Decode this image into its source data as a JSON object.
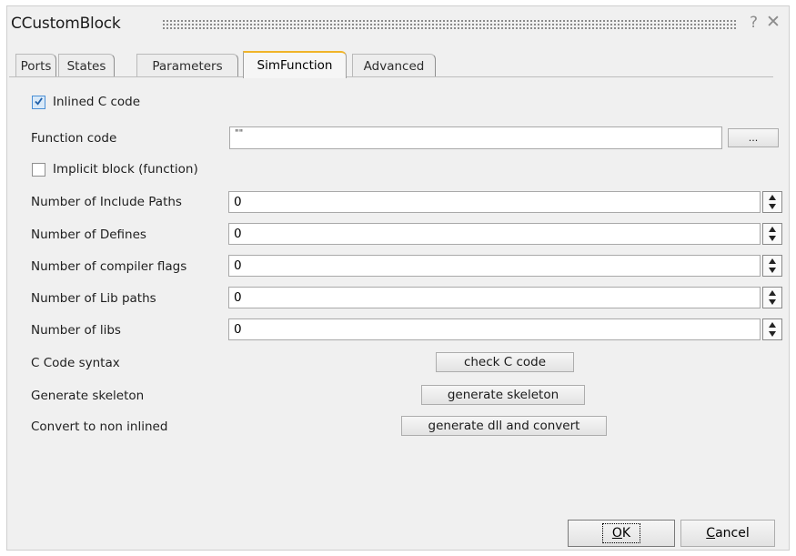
{
  "window": {
    "title": "CCustomBlock",
    "help_glyph": "?",
    "close_glyph": "✕"
  },
  "tabs": [
    {
      "label": "Ports"
    },
    {
      "label": "States"
    },
    {
      "label": "Parameters"
    },
    {
      "label": "SimFunction",
      "active": true
    },
    {
      "label": "Advanced"
    }
  ],
  "form": {
    "inlined": {
      "label": "Inlined C code",
      "checked": true
    },
    "function_code": {
      "label": "Function code",
      "value": "\"\"",
      "browse_label": "..."
    },
    "implicit": {
      "label": "Implicit block (function)",
      "checked": false
    },
    "include_paths": {
      "label": "Number of Include Paths",
      "value": "0"
    },
    "defines": {
      "label": "Number of Defines",
      "value": "0"
    },
    "compiler_flags": {
      "label": "Number of compiler flags",
      "value": "0"
    },
    "lib_paths": {
      "label": "Number of Lib paths",
      "value": "0"
    },
    "libs": {
      "label": "Number of libs",
      "value": "0"
    },
    "syntax": {
      "label": "C Code syntax",
      "button": "check C code"
    },
    "skeleton": {
      "label": "Generate skeleton",
      "button": "generate skeleton"
    },
    "convert": {
      "label": "Convert to non inlined",
      "button": "generate dll and convert"
    }
  },
  "footer": {
    "ok_mnemonic": "O",
    "ok_rest": "K",
    "cancel_mnemonic": "C",
    "cancel_rest": "ancel"
  },
  "colors": {
    "active_tab_accent": "#f0b429",
    "checkbox_accent": "#4a8fd6"
  }
}
